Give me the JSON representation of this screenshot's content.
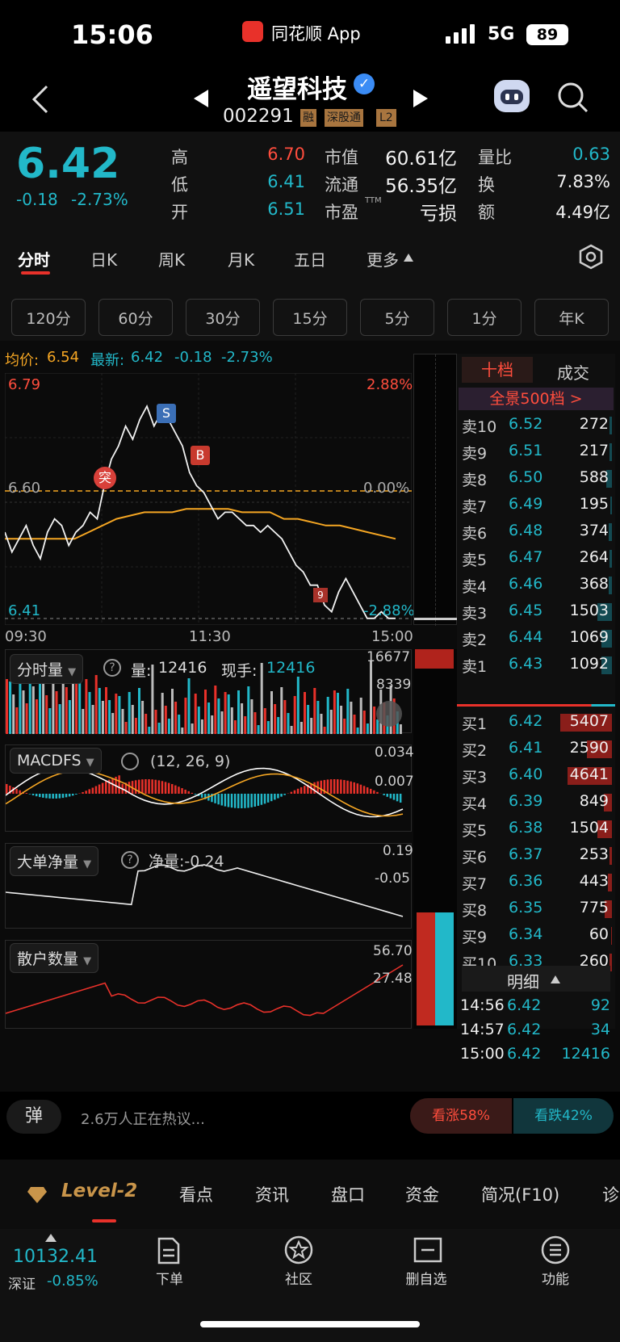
{
  "status": {
    "time": "15:06",
    "app_name": "同花顺 App",
    "network": "5G",
    "battery": "89"
  },
  "header": {
    "stock_name": "遥望科技",
    "stock_code": "002291",
    "tags": [
      "融",
      "深股通",
      "L2"
    ]
  },
  "quote": {
    "price": "6.42",
    "change": "-0.18",
    "change_pct": "-2.73%",
    "stats": [
      {
        "label": "高",
        "value": "6.70",
        "color": "red"
      },
      {
        "label": "低",
        "value": "6.41",
        "color": "cyan"
      },
      {
        "label": "开",
        "value": "6.51",
        "color": "cyan"
      },
      {
        "label": "市值",
        "value": "60.61亿",
        "color": "white"
      },
      {
        "label": "流通",
        "value": "56.35亿",
        "color": "white"
      },
      {
        "label": "市盈",
        "sup": "TTM",
        "value": "亏损",
        "color": "white"
      },
      {
        "label": "量比",
        "value": "0.63",
        "color": "cyan"
      },
      {
        "label": "换",
        "value": "7.83%",
        "color": "white"
      },
      {
        "label": "额",
        "value": "4.49亿",
        "color": "white"
      }
    ]
  },
  "tabs": [
    "分时",
    "日K",
    "周K",
    "月K",
    "五日",
    "更多"
  ],
  "periods": [
    "120分",
    "60分",
    "30分",
    "15分",
    "5分",
    "1分",
    "年K"
  ],
  "chart_info": {
    "avg_label": "均价:",
    "avg_value": "6.54",
    "latest_label": "最新:",
    "latest_value": "6.42",
    "latest_change": "-0.18",
    "latest_pct": "-2.73%"
  },
  "chart_data": {
    "type": "line",
    "x_ticks": [
      "09:30",
      "11:30",
      "15:00"
    ],
    "y_labels": {
      "high": "6.79",
      "base": "6.60",
      "low": "6.41"
    },
    "pct_labels": {
      "high": "2.88%",
      "base": "0.00%",
      "low": "-2.88%"
    },
    "series": [
      {
        "values": [
          6.55,
          6.52,
          6.54,
          6.56,
          6.53,
          6.51,
          6.55,
          6.57,
          6.56,
          6.53,
          6.55,
          6.56,
          6.58,
          6.57,
          6.62,
          6.66,
          6.68,
          6.71,
          6.69,
          6.72,
          6.74,
          6.71,
          6.73,
          6.72,
          6.7,
          6.68,
          6.64,
          6.62,
          6.61,
          6.59,
          6.57,
          6.58,
          6.58,
          6.57,
          6.56,
          6.56,
          6.55,
          6.56,
          6.55,
          6.54,
          6.52,
          6.5,
          6.49,
          6.47,
          6.47,
          6.44,
          6.43,
          6.46,
          6.48,
          6.46,
          6.44,
          6.42,
          6.42,
          6.43,
          6.42,
          6.42
        ]
      },
      {
        "name": "均价",
        "values": [
          6.54,
          6.54,
          6.54,
          6.54,
          6.54,
          6.54,
          6.55,
          6.56,
          6.57,
          6.575,
          6.58,
          6.58,
          6.58,
          6.585,
          6.585,
          6.585,
          6.585,
          6.58,
          6.58,
          6.58,
          6.57,
          6.57,
          6.565,
          6.56,
          6.56,
          6.555,
          6.55,
          6.545,
          6.54
        ]
      }
    ],
    "markers": [
      "S",
      "B",
      "突",
      "9"
    ]
  },
  "orderbook": {
    "tab_active": "十档",
    "tab_other": "成交",
    "banner": "全景500档 >",
    "asks": [
      {
        "label": "卖10",
        "price": "6.52",
        "vol": "272"
      },
      {
        "label": "卖9",
        "price": "6.51",
        "vol": "217"
      },
      {
        "label": "卖8",
        "price": "6.50",
        "vol": "588"
      },
      {
        "label": "卖7",
        "price": "6.49",
        "vol": "195"
      },
      {
        "label": "卖6",
        "price": "6.48",
        "vol": "374"
      },
      {
        "label": "卖5",
        "price": "6.47",
        "vol": "264"
      },
      {
        "label": "卖4",
        "price": "6.46",
        "vol": "368"
      },
      {
        "label": "卖3",
        "price": "6.45",
        "vol": "1503"
      },
      {
        "label": "卖2",
        "price": "6.44",
        "vol": "1069"
      },
      {
        "label": "卖1",
        "price": "6.43",
        "vol": "1092"
      }
    ],
    "bids": [
      {
        "label": "买1",
        "price": "6.42",
        "vol": "5407"
      },
      {
        "label": "买2",
        "price": "6.41",
        "vol": "2590"
      },
      {
        "label": "买3",
        "price": "6.40",
        "vol": "4641"
      },
      {
        "label": "买4",
        "price": "6.39",
        "vol": "849"
      },
      {
        "label": "买5",
        "price": "6.38",
        "vol": "1504"
      },
      {
        "label": "买6",
        "price": "6.37",
        "vol": "253"
      },
      {
        "label": "买7",
        "price": "6.36",
        "vol": "443"
      },
      {
        "label": "买8",
        "price": "6.35",
        "vol": "775"
      },
      {
        "label": "买9",
        "price": "6.34",
        "vol": "60"
      },
      {
        "label": "买10",
        "price": "6.33",
        "vol": "260"
      }
    ],
    "detail_label": "明细",
    "trades": [
      {
        "time": "14:56",
        "price": "6.42",
        "vol": "92"
      },
      {
        "time": "14:57",
        "price": "6.42",
        "vol": "34"
      },
      {
        "time": "15:00",
        "price": "6.42",
        "vol": "12416"
      }
    ]
  },
  "volume_panel": {
    "label": "分时量",
    "vol_label": "量:",
    "vol_value": "12416",
    "hand_label": "现手:",
    "hand_value": "12416",
    "max": "16677",
    "mid": "8339"
  },
  "macd_panel": {
    "label": "MACDFS",
    "params": "(12, 26, 9)",
    "top": "0.034",
    "mid": "0.007"
  },
  "bigorder_panel": {
    "label": "大单净量",
    "net_label": "净量:-0.24",
    "top": "0.19",
    "mid": "-0.05"
  },
  "retail_panel": {
    "label": "散户数量",
    "top": "56.70",
    "mid": "27.48"
  },
  "discussion": {
    "badge": "弹",
    "text": "2.6万人正在热议...",
    "up": "看涨58%",
    "down": "看跌42%"
  },
  "nav": [
    "Level-2",
    "看点",
    "资讯",
    "盘口",
    "资金",
    "简况(F10)",
    "诊"
  ],
  "dock": {
    "index_value": "10132.41",
    "index_name": "深证",
    "index_change": "-0.85%",
    "items": [
      "下单",
      "社区",
      "删自选",
      "功能"
    ]
  }
}
